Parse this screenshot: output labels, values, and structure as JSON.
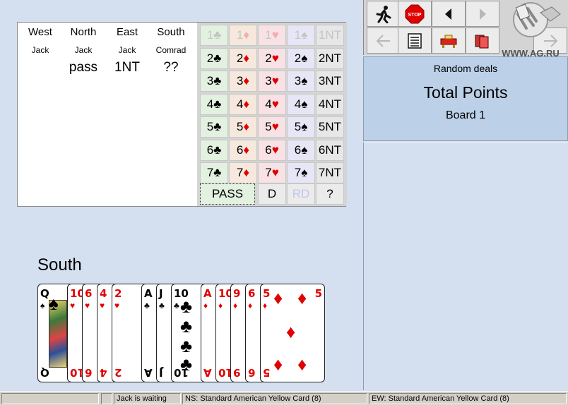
{
  "seats": [
    {
      "name": "West",
      "player": "Jack",
      "call": ""
    },
    {
      "name": "North",
      "player": "Jack",
      "call": "pass"
    },
    {
      "name": "East",
      "player": "Jack",
      "call": "1NT"
    },
    {
      "name": "South",
      "player": "Comrad",
      "call": "??"
    }
  ],
  "bid_levels": [
    "1",
    "2",
    "3",
    "4",
    "5",
    "6",
    "7"
  ],
  "strain_labels": {
    "nt": "NT"
  },
  "call_buttons": {
    "pass": "PASS",
    "double": "D",
    "redouble": "RD",
    "help": "?"
  },
  "suit_glyphs": {
    "clubs": "♣",
    "diamonds": "♦",
    "hearts": "♥",
    "spades": "♠"
  },
  "hand": {
    "label": "South",
    "cards": [
      {
        "rank": "Q",
        "suit": "♠",
        "color": "black"
      },
      {
        "rank": "10",
        "suit": "♥",
        "color": "red"
      },
      {
        "rank": "6",
        "suit": "♥",
        "color": "red"
      },
      {
        "rank": "4",
        "suit": "♥",
        "color": "red"
      },
      {
        "rank": "2",
        "suit": "♥",
        "color": "red"
      },
      {
        "rank": "A",
        "suit": "♣",
        "color": "black"
      },
      {
        "rank": "J",
        "suit": "♣",
        "color": "black"
      },
      {
        "rank": "10",
        "suit": "♣",
        "color": "black"
      },
      {
        "rank": "A",
        "suit": "♦",
        "color": "red"
      },
      {
        "rank": "10",
        "suit": "♦",
        "color": "red"
      },
      {
        "rank": "9",
        "suit": "♦",
        "color": "red"
      },
      {
        "rank": "6",
        "suit": "♦",
        "color": "red"
      },
      {
        "rank": "5",
        "suit": "♦",
        "color": "red"
      }
    ]
  },
  "toolbar": {
    "stop_label": "STOP",
    "icons": [
      "run-icon",
      "stop-icon",
      "back-arrow-icon",
      "forward-arrow-icon",
      "undo-arrow-icon",
      "scoresheet-icon",
      "table-icon",
      "cards-icon",
      "redo-arrow-icon"
    ]
  },
  "logo": {
    "text": "WWW.AG.RU"
  },
  "info": {
    "mode": "Random deals",
    "title": "Total Points",
    "board": "Board 1"
  },
  "status": {
    "cell1": "",
    "waiting": "Jack is waiting",
    "ns_card": "NS: Standard American Yellow Card (8)",
    "ew_card": "EW: Standard American Yellow Card (8)"
  },
  "colors": {
    "background": "#d4e0f0",
    "info_panel": "#bcd0e8",
    "red_suit": "#e00000",
    "clubs_col": "#e3f1e0",
    "diamonds_col": "#f6e8dd",
    "hearts_col": "#f8e2e5",
    "spades_col": "#e6e6f7"
  }
}
